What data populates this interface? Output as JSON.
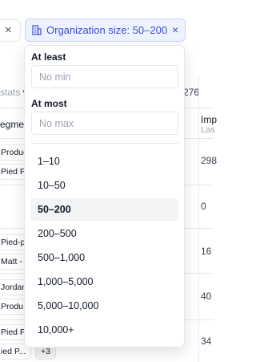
{
  "filter_chip": {
    "label": "Organization size: 50–200",
    "icon": "building-icon",
    "close_icon": "×"
  },
  "background": {
    "left_chip_close": "×",
    "stats_prefix": "stats ",
    "stats_bold": "v",
    "count": "276",
    "col_segment": "egmer",
    "col_imp": "Imp",
    "col_imp_sub": "Las",
    "rows": [
      {
        "tags": [
          "Product",
          "Pied P"
        ],
        "value": "298"
      },
      {
        "tags": [],
        "value": "0"
      },
      {
        "tags": [
          "Pied-pip",
          "Matt -"
        ],
        "value": "16"
      },
      {
        "tags": [
          "Jordan",
          "Produ"
        ],
        "value": "40"
      },
      {
        "tags": [
          "Pied Pip",
          "ied P..."
        ],
        "plus": "+3",
        "value": "34"
      }
    ]
  },
  "dropdown": {
    "at_least_label": "At least",
    "at_least_placeholder": "No min",
    "at_most_label": "At most",
    "at_most_placeholder": "No max",
    "options": [
      "1–10",
      "10–50",
      "50–200",
      "200–500",
      "500–1,000",
      "1,000–5,000",
      "5,000–10,000",
      "10,000+"
    ],
    "selected": "50–200"
  }
}
